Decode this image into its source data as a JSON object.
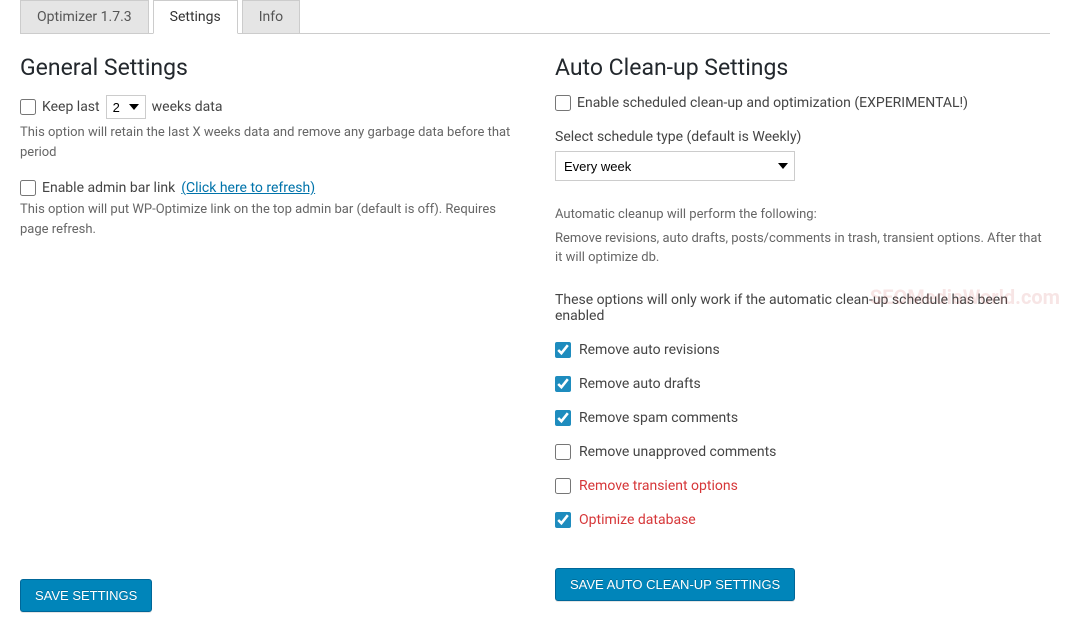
{
  "tabs": {
    "optimizer": "Optimizer 1.7.3",
    "settings": "Settings",
    "info": "Info"
  },
  "general": {
    "heading": "General Settings",
    "keep_last_prefix": "Keep last",
    "keep_last_value": "2",
    "keep_last_suffix": "weeks data",
    "keep_last_desc": "This option will retain the last X weeks data and remove any garbage data before that period",
    "enable_admin_label": "Enable admin bar link",
    "enable_admin_link": "(Click here to refresh)",
    "enable_admin_desc": "This option will put WP-Optimize link on the top admin bar (default is off). Requires page refresh.",
    "save_btn": "SAVE SETTINGS"
  },
  "auto": {
    "heading": "Auto Clean-up Settings",
    "enable_label": "Enable scheduled clean-up and optimization (EXPERIMENTAL!)",
    "schedule_label": "Select schedule type (default is Weekly)",
    "schedule_value": "Every week",
    "perform_heading": "Automatic cleanup will perform the following:",
    "perform_body": "Remove revisions, auto drafts, posts/comments in trash, transient options. After that it will optimize db.",
    "work_note": "These options will only work if the automatic clean-up schedule has been enabled",
    "options": [
      {
        "label": "Remove auto revisions",
        "checked": true,
        "warn": false,
        "name": "opt-remove-revisions"
      },
      {
        "label": "Remove auto drafts",
        "checked": true,
        "warn": false,
        "name": "opt-remove-drafts"
      },
      {
        "label": "Remove spam comments",
        "checked": true,
        "warn": false,
        "name": "opt-remove-spam"
      },
      {
        "label": "Remove unapproved comments",
        "checked": false,
        "warn": false,
        "name": "opt-remove-unapproved"
      },
      {
        "label": "Remove transient options",
        "checked": false,
        "warn": true,
        "name": "opt-remove-transient"
      },
      {
        "label": "Optimize database",
        "checked": true,
        "warn": true,
        "name": "opt-optimize-db"
      }
    ],
    "save_btn": "SAVE AUTO CLEAN-UP SETTINGS"
  },
  "watermark": "SEOMediaWorld.com"
}
